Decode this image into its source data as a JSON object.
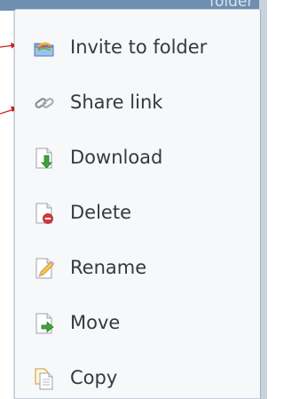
{
  "header": {
    "peek_text": "folder"
  },
  "menu": {
    "items": [
      {
        "label": "Invite to folder",
        "icon": "invite-folder-icon"
      },
      {
        "label": "Share link",
        "icon": "link-icon"
      },
      {
        "label": "Download",
        "icon": "download-icon"
      },
      {
        "label": "Delete",
        "icon": "delete-icon"
      },
      {
        "label": "Rename",
        "icon": "rename-icon"
      },
      {
        "label": "Move",
        "icon": "move-icon"
      },
      {
        "label": "Copy",
        "icon": "copy-icon"
      }
    ]
  },
  "colors": {
    "arrow": "#cc1a1a",
    "text": "#333a40",
    "menu_bg": "#f7f8fa"
  }
}
